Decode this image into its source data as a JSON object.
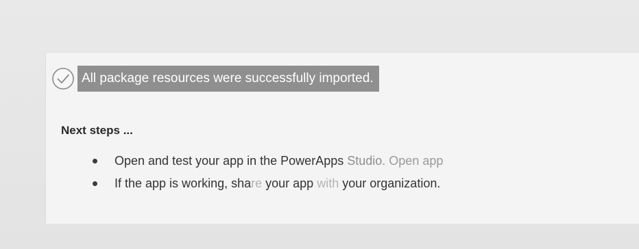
{
  "status": {
    "icon": "check-circle-icon",
    "message": "All package resources were successfully imported."
  },
  "next_steps": {
    "heading": "Next steps ...",
    "items": [
      {
        "text_a": "Open and test your app in the PowerApps",
        "text_b": "Studio.",
        "link": "Open app"
      },
      {
        "text_a": "If the app is working, sha",
        "text_faint": "re",
        "text_b": "your app",
        "text_c": "with",
        "text_d": "your organization."
      }
    ]
  },
  "colors": {
    "highlight": "#8f8f8f",
    "panel": "#f4f4f4",
    "background": "#e6e6e6"
  }
}
